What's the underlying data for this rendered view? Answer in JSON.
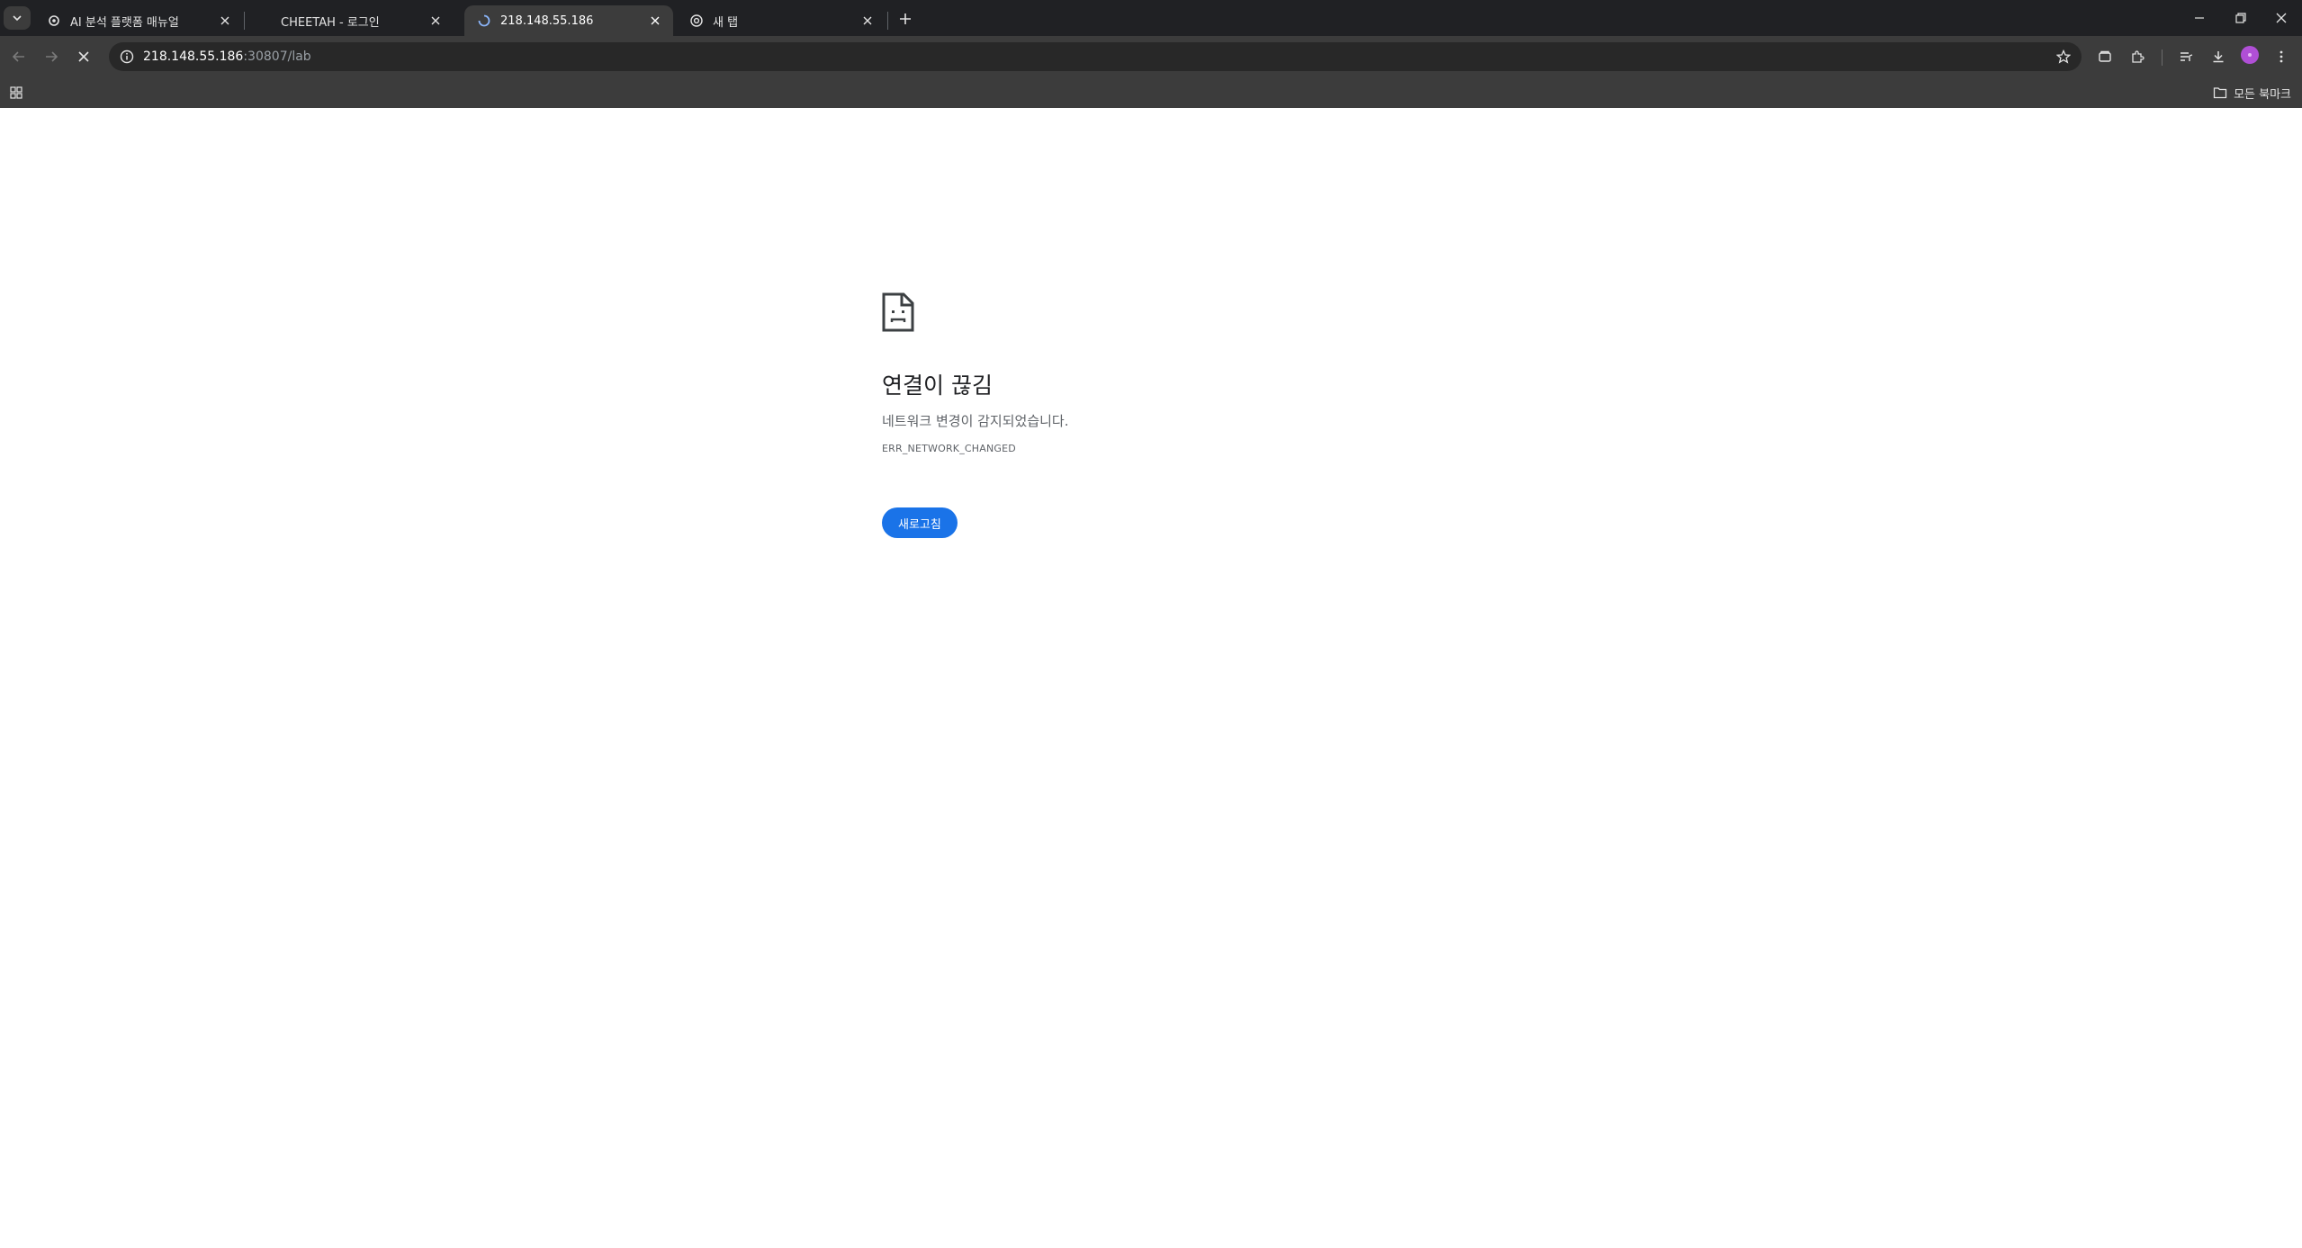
{
  "tabs": [
    {
      "title": "AI 분석 플랫폼 매뉴얼",
      "active": false,
      "favicon": "gear-icon"
    },
    {
      "title": "CHEETAH - 로그인",
      "active": false,
      "favicon": "none"
    },
    {
      "title": "218.148.55.186",
      "active": true,
      "favicon": "loading-spinner-icon"
    },
    {
      "title": "새 탭",
      "active": false,
      "favicon": "chrome-icon"
    }
  ],
  "address_bar": {
    "host": "218.148.55.186",
    "path": ":30807/lab"
  },
  "bookmarks_bar": {
    "all_bookmarks_label": "모든 북마크"
  },
  "error_page": {
    "title": "연결이 끊김",
    "description": "네트워크 변경이 감지되었습니다.",
    "error_code": "ERR_NETWORK_CHANGED",
    "reload_label": "새로고침"
  },
  "colors": {
    "tabstrip_bg": "#202124",
    "toolbar_bg": "#3c3c3c",
    "reload_button": "#1a73e8",
    "avatar": "#b04fd6"
  }
}
